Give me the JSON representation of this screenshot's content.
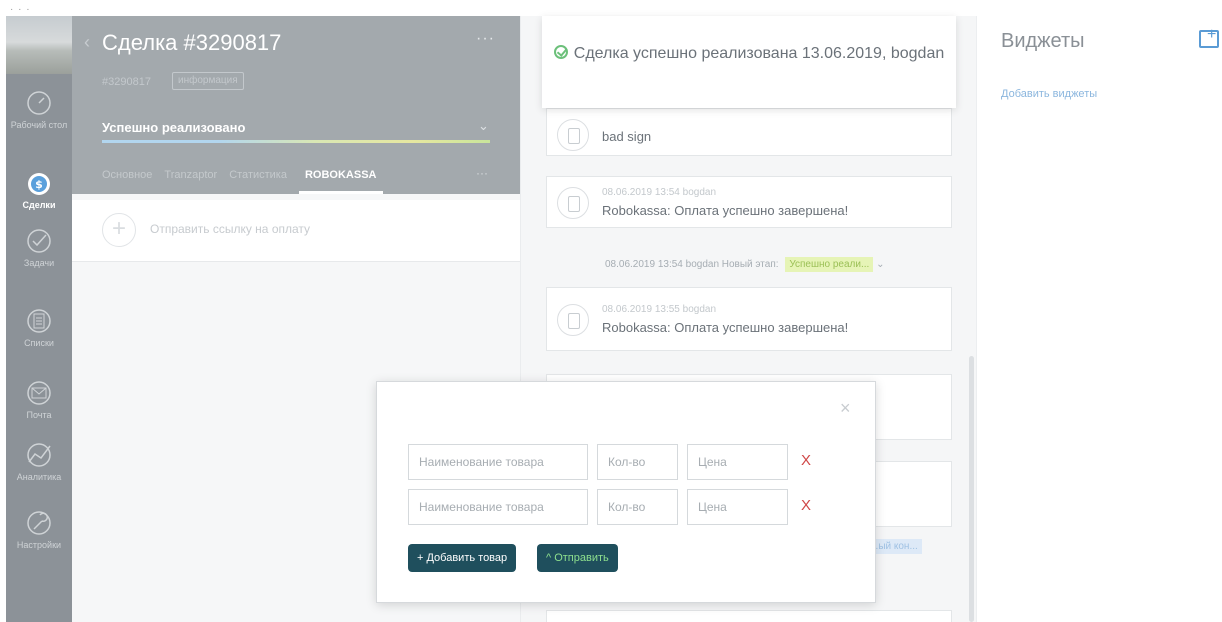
{
  "deal": {
    "title": "Сделка #3290817",
    "menu_dots": "···",
    "sub_id": "#3290817",
    "sub_tag": "информация",
    "stage": "Успешно реализовано",
    "stage_chevron": "⌄",
    "tabs": [
      {
        "label": "Основное"
      },
      {
        "label": "Tranzaptor"
      },
      {
        "label": "Статистика"
      },
      {
        "label": "ROBOKASSA"
      }
    ],
    "tabs_more": "···",
    "pay_link_plus": "+",
    "pay_link_text": "Отправить ссылку на оплату"
  },
  "nav": {
    "items": [
      {
        "label": "Рабочий стол"
      },
      {
        "label": "Сделки"
      },
      {
        "label": "Задачи"
      },
      {
        "label": "Списки"
      },
      {
        "label": "Почта"
      },
      {
        "label": "Аналитика"
      },
      {
        "label": "Настройки"
      }
    ]
  },
  "toast": {
    "text": "Сделка успешно реализована 13.06.2019, bogdan"
  },
  "feed": {
    "cards": [
      {
        "meta": "",
        "text": "bad sign"
      },
      {
        "meta": "08.06.2019 13:54 bogdan",
        "text": "Robokassa: Оплата успешно завершена!"
      },
      {
        "meta": "08.06.2019 13:55 bogdan",
        "text": "Robokassa: Оплата успешно завершена!"
      }
    ],
    "stage_change_meta": "08.06.2019 13:54 bogdan  Новый этап:",
    "stage_change_pill": "Успешно реали...",
    "stage_change_chev": "⌄",
    "stage_pill_2": "...ый кон..."
  },
  "widgets": {
    "title": "Виджеты",
    "add_link": "Добавить виджеты"
  },
  "modal": {
    "close": "×",
    "rows": [
      {
        "name_placeholder": "Наименование товара",
        "qty_placeholder": "Кол-во",
        "price_placeholder": "Цена",
        "delete": "X"
      },
      {
        "name_placeholder": "Наименование товара",
        "qty_placeholder": "Кол-во",
        "price_placeholder": "Цена",
        "delete": "X"
      }
    ],
    "add_button": "+ Добавить товар",
    "send_button": "^ Отправить"
  }
}
